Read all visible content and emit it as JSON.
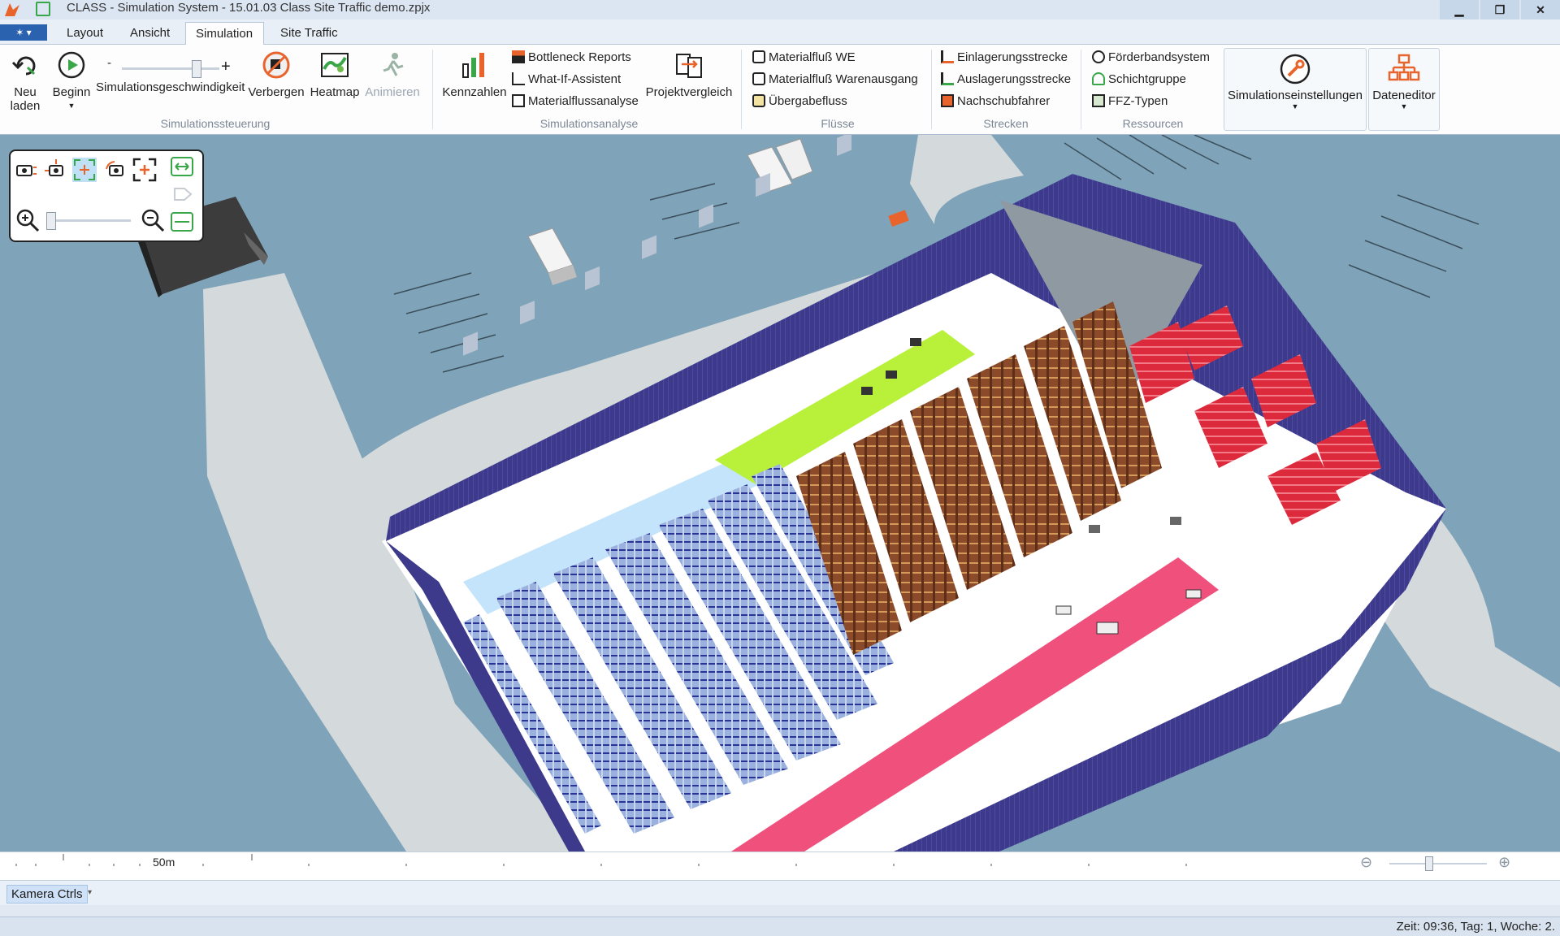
{
  "window": {
    "title": "CLASS - Simulation System -  15.01.03 Class Site Traffic demo.zpjx",
    "controls": {
      "minimize": "▁",
      "restore": "❐",
      "close": "✕"
    }
  },
  "tabs": [
    {
      "label": "Layout"
    },
    {
      "label": "Ansicht"
    },
    {
      "label": "Simulation",
      "active": true
    },
    {
      "label": "Site Traffic"
    }
  ],
  "ribbon": {
    "simulationssteuerung": {
      "group_label": "Simulationssteuerung",
      "neu_laden": "Neu\nladen",
      "beginn": "Beginn",
      "speed_label": "Simulationsgeschwindigkeit",
      "speed_minus": "-",
      "speed_plus": "+",
      "speed_level": 0.78,
      "verbergen": "Verbergen",
      "heatmap": "Heatmap",
      "animieren": "Animieren"
    },
    "simulationsanalyse": {
      "group_label": "Simulationsanalyse",
      "kennzahlen": "Kennzahlen",
      "bottleneck": "Bottleneck Reports",
      "whatif": "What-If-Assistent",
      "materialflussanalyse": "Materialflussanalyse",
      "projektvergleich": "Projektvergleich"
    },
    "fluesse": {
      "group_label": "Flüsse",
      "we": "Materialfluß WE",
      "wa": "Materialfluß Warenausgang",
      "uebergabe": "Übergabefluss"
    },
    "strecken": {
      "group_label": "Strecken",
      "einlagerung": "Einlagerungsstrecke",
      "auslagerung": "Auslagerungsstrecke",
      "nachschub": "Nachschubfahrer"
    },
    "ressourcen": {
      "group_label": "Ressourcen",
      "foerderband": "Förderbandsystem",
      "schicht": "Schichtgruppe",
      "ffz": "FFZ-Typen"
    },
    "simulationseinstellungen": "Simulationseinstellungen",
    "dateneditor": "Dateneditor"
  },
  "ruler": {
    "scale_label": "50m"
  },
  "panel": {
    "tab_label": "Kamera Ctrls"
  },
  "status": {
    "text": "Zeit: 09:36, Tag: 1, Woche: 2."
  },
  "colors": {
    "ground": "#7fa3b8",
    "road": "#d4d9dc",
    "wall": "#3d3a8c",
    "floor": "#ffffff",
    "rack_blue": "#8fa6d4",
    "rack_brown": "#8b4a2a",
    "rack_red": "#d8283c",
    "zone_green": "#b8f03a",
    "zone_pink": "#f0507c",
    "zone_lightblue": "#c4e4fb"
  }
}
